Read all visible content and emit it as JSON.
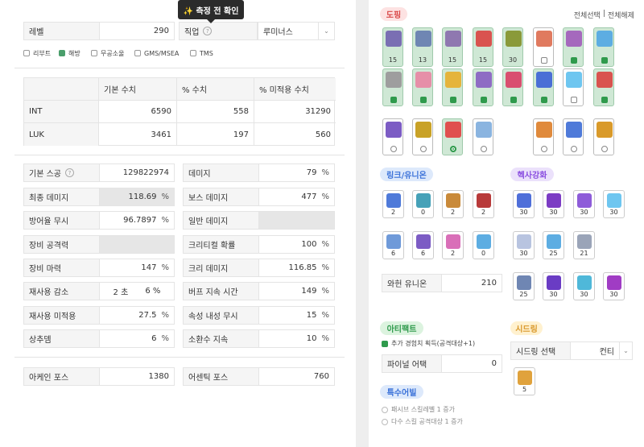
{
  "tooltip": {
    "icon": "sparkles-icon",
    "text": "✨ 측정 전 확인"
  },
  "basic": {
    "level_label": "레벨",
    "level_value": "290",
    "job_label": "직업",
    "job_value": "루미너스"
  },
  "server_options": [
    {
      "label": "리부트",
      "checked": false
    },
    {
      "label": "해방",
      "checked": true
    },
    {
      "label": "무공소울",
      "checked": false
    },
    {
      "label": "GMS/MSEA",
      "checked": false
    },
    {
      "label": "TMS",
      "checked": false
    }
  ],
  "stat_table": {
    "headers": [
      "",
      "기본 수치",
      "% 수치",
      "% 미적용 수치"
    ],
    "rows": [
      {
        "name": "INT",
        "base": "6590",
        "pct": "558",
        "flat": "31290"
      },
      {
        "name": "LUK",
        "base": "3461",
        "pct": "197",
        "flat": "560"
      }
    ]
  },
  "stats_left": [
    {
      "label": "기본 스공",
      "value": "129822974",
      "unit": "",
      "info": true
    },
    {
      "label": "최종 데미지",
      "value": "118.69",
      "unit": "%",
      "shaded": true
    },
    {
      "label": "방어율 무시",
      "value": "96.7897",
      "unit": "%"
    },
    {
      "label": "장비 공격력",
      "value": "",
      "unit": "",
      "disabled": true
    },
    {
      "label": "장비 마력",
      "value": "147",
      "unit": "%"
    },
    {
      "label": "재사용 감소",
      "value": "2 초",
      "unit": "6 %"
    },
    {
      "label": "재사용 미적용",
      "value": "27.5",
      "unit": "%"
    },
    {
      "label": "상추뎀",
      "value": "6",
      "unit": "%"
    }
  ],
  "stats_right": [
    {
      "label": "데미지",
      "value": "79",
      "unit": "%"
    },
    {
      "label": "보스 데미지",
      "value": "477",
      "unit": "%"
    },
    {
      "label": "일반 데미지",
      "value": "",
      "unit": "",
      "disabled": true
    },
    {
      "label": "크리티컬 확률",
      "value": "100",
      "unit": "%"
    },
    {
      "label": "크리 데미지",
      "value": "116.85",
      "unit": "%"
    },
    {
      "label": "버프 지속 시간",
      "value": "149",
      "unit": "%"
    },
    {
      "label": "속성 내성 무시",
      "value": "15",
      "unit": "%"
    },
    {
      "label": "소환수 지속",
      "value": "10",
      "unit": "%"
    }
  ],
  "force": {
    "arcane_label": "아케인 포스",
    "arcane_value": "1380",
    "authentic_label": "어센틱 포스",
    "authentic_value": "760"
  },
  "doping": {
    "title": "도핑",
    "select_all": "전체선택",
    "divider": "|",
    "deselect_all": "전체해제",
    "row1": [
      {
        "icon": "scroll-icon",
        "color": "#7a6fb3",
        "count": "15",
        "on": true
      },
      {
        "icon": "scroll-icon",
        "color": "#6f86b3",
        "count": "13",
        "on": true
      },
      {
        "icon": "scroll-icon",
        "color": "#8f78b0",
        "count": "15",
        "on": true
      },
      {
        "icon": "compass-icon",
        "color": "#d9534f",
        "count": "15",
        "on": true
      },
      {
        "icon": "potion-icon",
        "color": "#8a9a3a",
        "count": "30",
        "on": true
      },
      {
        "icon": "candy-icon",
        "color": "#e07a5f",
        "count": "",
        "on": false
      },
      {
        "icon": "cube-icon",
        "color": "#a569bd",
        "count": "",
        "on": true
      },
      {
        "icon": "crystal-icon",
        "color": "#5dade2",
        "count": "",
        "on": true
      }
    ],
    "row2": [
      {
        "icon": "clock-icon",
        "color": "#9e9e9e",
        "on": true
      },
      {
        "icon": "bag-icon",
        "color": "#e68fa8",
        "on": true
      },
      {
        "icon": "chest-icon",
        "color": "#e5b43c",
        "on": true
      },
      {
        "icon": "gift-icon",
        "color": "#8e6cc4",
        "on": true
      },
      {
        "icon": "flask-icon",
        "color": "#d94f70",
        "on": true
      },
      {
        "icon": "flask-icon",
        "color": "#4a6fd6",
        "on": true
      },
      {
        "icon": "ice-icon",
        "color": "#6ec6f0",
        "on": false
      },
      {
        "icon": "vip-icon",
        "color": "#d9534f",
        "on": true
      }
    ],
    "row3": [
      {
        "icon": "hat-icon",
        "color": "#7c5cc4",
        "on": false
      },
      {
        "icon": "sword-icon",
        "color": "#c9a227",
        "on": false
      },
      {
        "icon": "medkit-icon",
        "color": "#e0504f",
        "on": true
      },
      {
        "icon": "candy-icon",
        "color": "#8ab4e0",
        "on": false
      },
      {
        "icon": "fish-icon",
        "color": "#e08a3c",
        "on": false
      },
      {
        "icon": "bottle-icon",
        "color": "#4f7ad9",
        "on": false
      },
      {
        "icon": "angel-icon",
        "color": "#d99a2a",
        "on": false
      }
    ]
  },
  "link_union": {
    "title": "링크/유니온",
    "skills": [
      {
        "icon": "link-skill-icon",
        "color": "#4f7ad9",
        "value": "2"
      },
      {
        "icon": "link-skill-icon",
        "color": "#46a1b8",
        "value": "0"
      },
      {
        "icon": "link-skill-icon",
        "color": "#c98a3a",
        "value": "2"
      },
      {
        "icon": "link-skill-icon",
        "color": "#b83a3a",
        "value": "2"
      },
      {
        "icon": "link-skill-icon",
        "color": "#6f9ad9",
        "value": "6"
      },
      {
        "icon": "link-skill-icon",
        "color": "#7c5cc4",
        "value": "6"
      },
      {
        "icon": "link-skill-icon",
        "color": "#d96fb8",
        "value": "2"
      },
      {
        "icon": "link-skill-icon",
        "color": "#5dade2",
        "value": "0"
      }
    ],
    "wahun_label": "와헌 유니온",
    "wahun_value": "210"
  },
  "hexa": {
    "title": "헥사강화",
    "skills": [
      {
        "icon": "hexa-skill-icon",
        "color": "#4f6fd9",
        "value": "30"
      },
      {
        "icon": "hexa-skill-icon",
        "color": "#7c3cc4",
        "value": "30"
      },
      {
        "icon": "hexa-skill-icon",
        "color": "#8e5cd9",
        "value": "30"
      },
      {
        "icon": "hexa-skill-icon",
        "color": "#6ec6f0",
        "value": "30"
      },
      {
        "icon": "hexa-skill-icon",
        "color": "#b8c4e0",
        "value": "30"
      },
      {
        "icon": "hexa-skill-icon",
        "color": "#5dade2",
        "value": "25"
      },
      {
        "icon": "hexa-skill-icon",
        "color": "#9aa4b8",
        "value": "21"
      },
      {
        "icon": "hexa-skill-icon",
        "color": "#6f86b3",
        "value": "25"
      },
      {
        "icon": "hexa-skill-icon",
        "color": "#6a3cc4",
        "value": "30"
      },
      {
        "icon": "hexa-skill-icon",
        "color": "#4fb8d9",
        "value": "30"
      },
      {
        "icon": "hexa-skill-icon",
        "color": "#a03cc4",
        "value": "30"
      }
    ]
  },
  "artifact": {
    "title": "아티팩트",
    "exp_label": "추가 경험치 획득(공격대상+1)",
    "final_label": "파이널 어택",
    "final_value": "0"
  },
  "seed": {
    "title": "시드링",
    "select_label": "시드링 선택",
    "select_value": "컨티",
    "ring_icon": "ring-icon",
    "ring_value": "5"
  },
  "special": {
    "title": "특수어빌",
    "options": [
      "패시브 스킬레벨 1 증가",
      "다수 스킬 공격대상 1 증가"
    ]
  },
  "colors": {
    "green": "#2f9a4c",
    "red": "#d94848",
    "blue": "#3b72d9",
    "purple": "#8a4ee0",
    "yellow": "#d9982a"
  }
}
